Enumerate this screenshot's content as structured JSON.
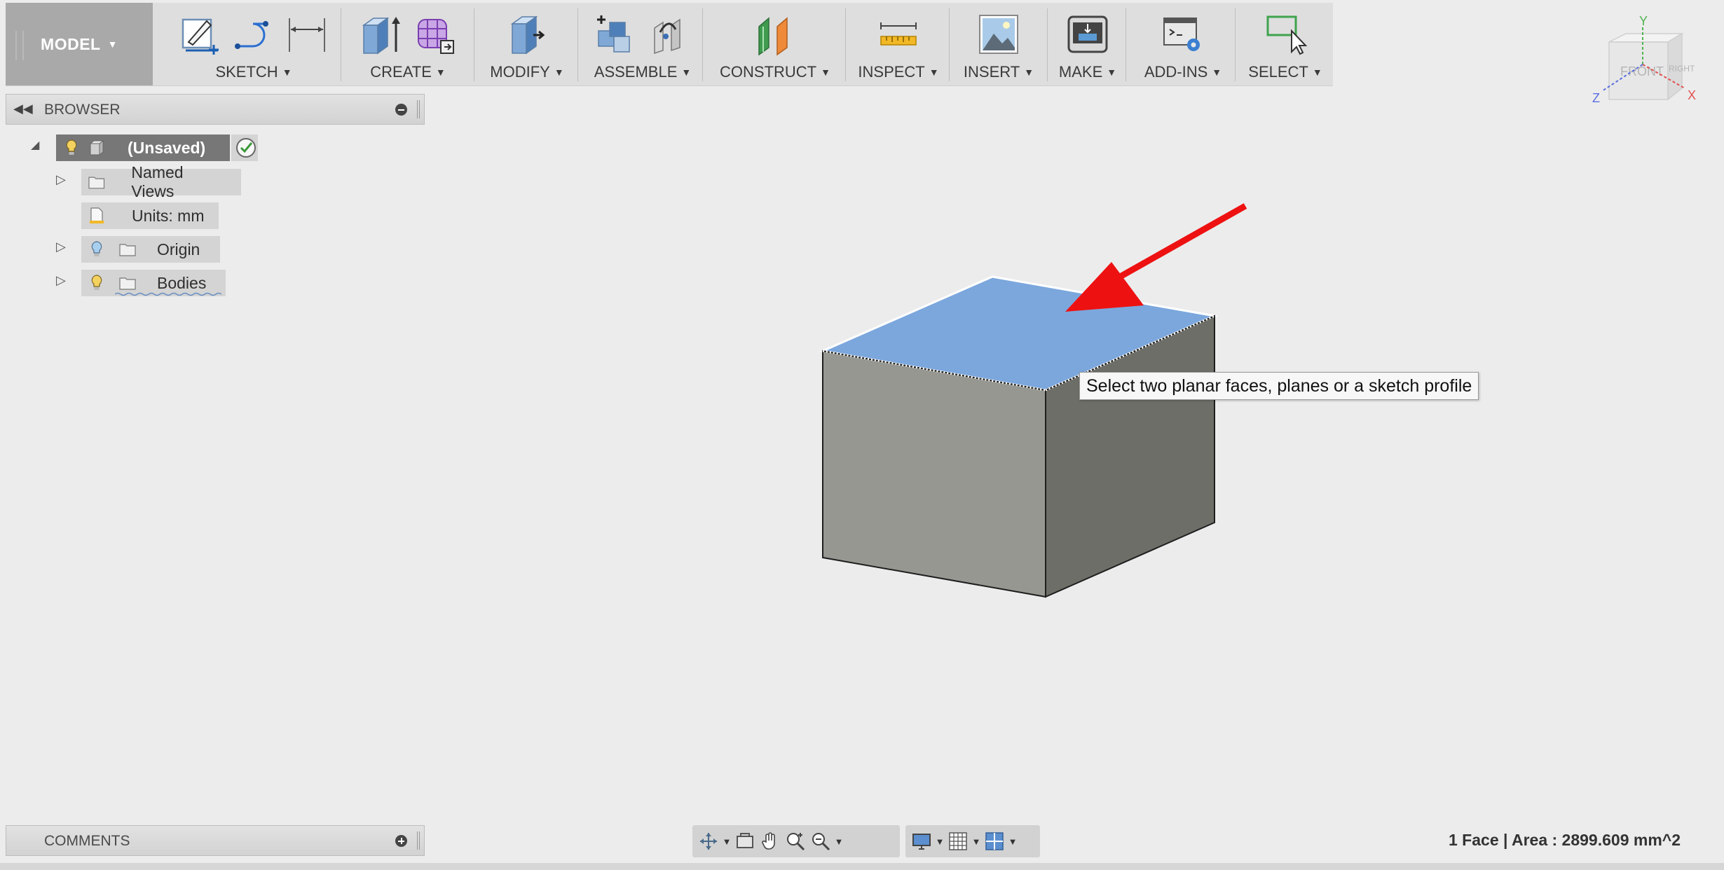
{
  "toolbar": {
    "workspace": "MODEL",
    "groups": {
      "sketch": "SKETCH",
      "create": "CREATE",
      "modify": "MODIFY",
      "assemble": "ASSEMBLE",
      "construct": "CONSTRUCT",
      "inspect": "INSPECT",
      "insert": "INSERT",
      "make": "MAKE",
      "addins": "ADD-INS",
      "select": "SELECT"
    }
  },
  "viewcube": {
    "front": "FRONT",
    "right": "RIGHT",
    "axis_x": "X",
    "axis_y": "Y",
    "axis_z": "Z"
  },
  "browser": {
    "title": "BROWSER",
    "root": "(Unsaved)",
    "items": [
      {
        "label": "Named Views",
        "icon": "folder-icon"
      },
      {
        "label": "Units: mm",
        "icon": "document-icon"
      },
      {
        "label": "Origin",
        "icon": "folder-icon"
      },
      {
        "label": "Bodies",
        "icon": "folder-icon"
      }
    ]
  },
  "canvas": {
    "tooltip": "Select two planar faces, planes or a sketch profile",
    "colors": {
      "selected_face": "#7ba7dd",
      "front_face": "#979791",
      "side_face": "#6e6e68",
      "annotation_arrow": "#ee1111"
    }
  },
  "comments": {
    "title": "COMMENTS"
  },
  "status": {
    "selection": "1 Face | Area : 2899.609 mm^2"
  }
}
